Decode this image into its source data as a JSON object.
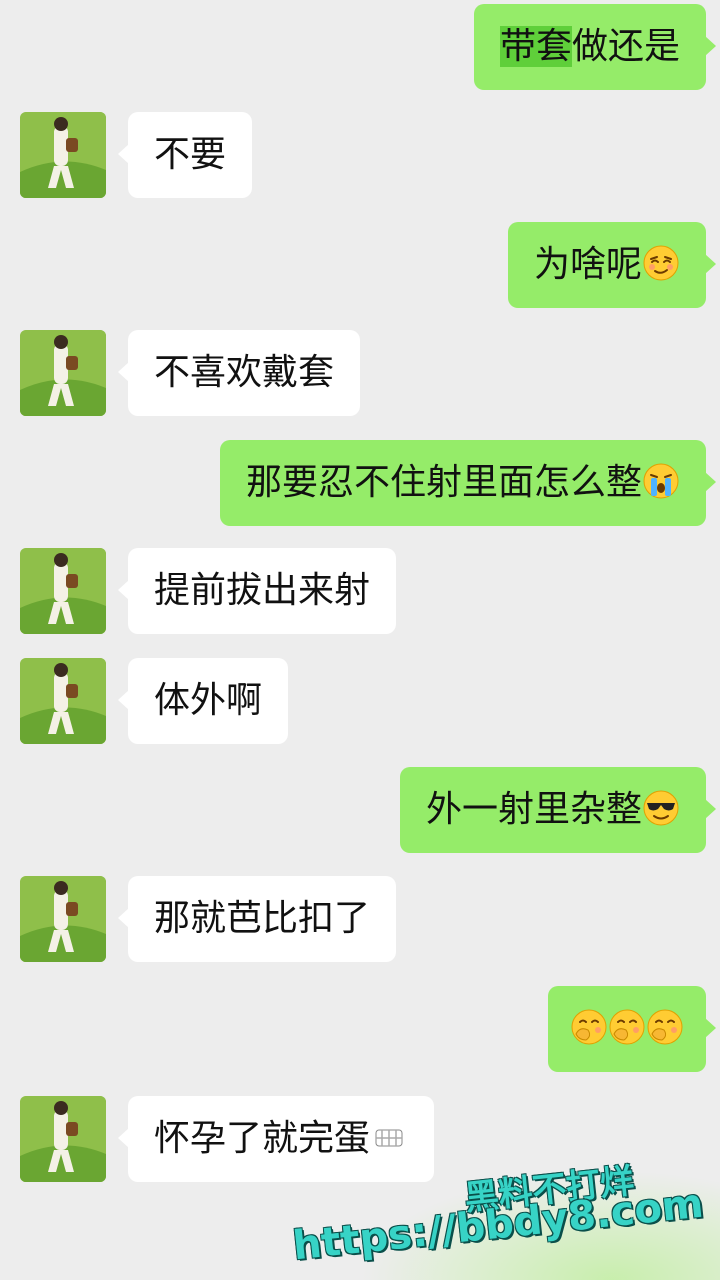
{
  "colors": {
    "background": "#ededed",
    "bubble_self": "#95ec69",
    "bubble_other": "#ffffff",
    "watermark": "#37d3c6"
  },
  "messages": [
    {
      "side": "right",
      "parts": [
        {
          "text": "带套",
          "highlight": true
        },
        {
          "text": "做还是"
        }
      ]
    },
    {
      "side": "left",
      "text": "不要"
    },
    {
      "side": "right",
      "text": "为啥呢",
      "emoji": "smirk-face-icon"
    },
    {
      "side": "left",
      "text": "不喜欢戴套"
    },
    {
      "side": "right",
      "text": "那要忍不住射里面怎么整",
      "emoji": "crying-face-icon"
    },
    {
      "side": "left",
      "text": "提前拔出来射"
    },
    {
      "side": "left",
      "text": "体外啊"
    },
    {
      "side": "right",
      "text": "外一射里杂整",
      "emoji": "sunglasses-face-icon"
    },
    {
      "side": "left",
      "text": "那就芭比扣了"
    },
    {
      "side": "right",
      "emojis": [
        "hand-over-mouth-face-icon",
        "hand-over-mouth-face-icon",
        "hand-over-mouth-face-icon"
      ]
    },
    {
      "side": "left",
      "text": "怀孕了就完蛋",
      "emoji": "grimace-icon"
    }
  ],
  "watermark": {
    "line1": "黑料不打烊",
    "line2": "https://bbdy8.com"
  }
}
